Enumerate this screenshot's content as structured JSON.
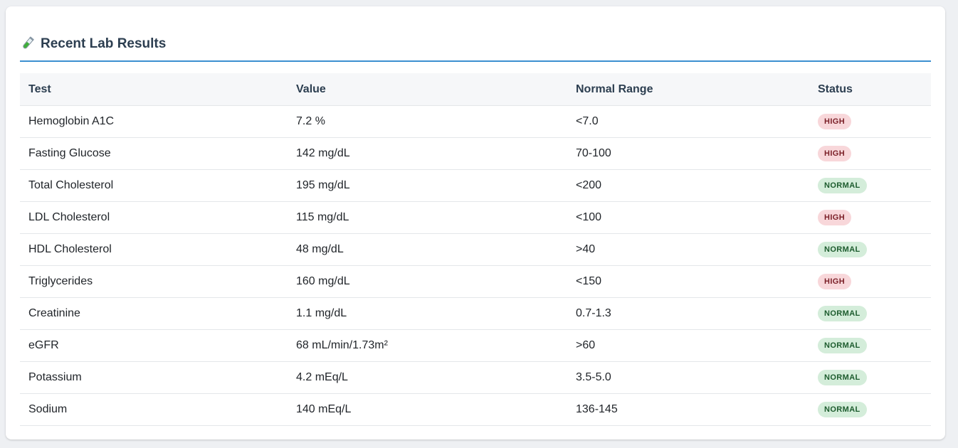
{
  "section": {
    "title": "Recent Lab Results",
    "icon": "test-tube-icon"
  },
  "columns": {
    "test": "Test",
    "value": "Value",
    "range": "Normal Range",
    "status": "Status"
  },
  "colors": {
    "accent": "#3b8fd0",
    "high_bg": "#f8d7da",
    "high_fg": "#7a1f27",
    "normal_bg": "#d4edda",
    "normal_fg": "#1d5c2e"
  },
  "rows": [
    {
      "test": "Hemoglobin A1C",
      "value": "7.2 %",
      "range": "<7.0",
      "status": "HIGH",
      "level": "high"
    },
    {
      "test": "Fasting Glucose",
      "value": "142 mg/dL",
      "range": "70-100",
      "status": "HIGH",
      "level": "high"
    },
    {
      "test": "Total Cholesterol",
      "value": "195 mg/dL",
      "range": "<200",
      "status": "NORMAL",
      "level": "normal"
    },
    {
      "test": "LDL Cholesterol",
      "value": "115 mg/dL",
      "range": "<100",
      "status": "HIGH",
      "level": "high"
    },
    {
      "test": "HDL Cholesterol",
      "value": "48 mg/dL",
      "range": ">40",
      "status": "NORMAL",
      "level": "normal"
    },
    {
      "test": "Triglycerides",
      "value": "160 mg/dL",
      "range": "<150",
      "status": "HIGH",
      "level": "high"
    },
    {
      "test": "Creatinine",
      "value": "1.1 mg/dL",
      "range": "0.7-1.3",
      "status": "NORMAL",
      "level": "normal"
    },
    {
      "test": "eGFR",
      "value": "68 mL/min/1.73m²",
      "range": ">60",
      "status": "NORMAL",
      "level": "normal"
    },
    {
      "test": "Potassium",
      "value": "4.2 mEq/L",
      "range": "3.5-5.0",
      "status": "NORMAL",
      "level": "normal"
    },
    {
      "test": "Sodium",
      "value": "140 mEq/L",
      "range": "136-145",
      "status": "NORMAL",
      "level": "normal"
    }
  ]
}
